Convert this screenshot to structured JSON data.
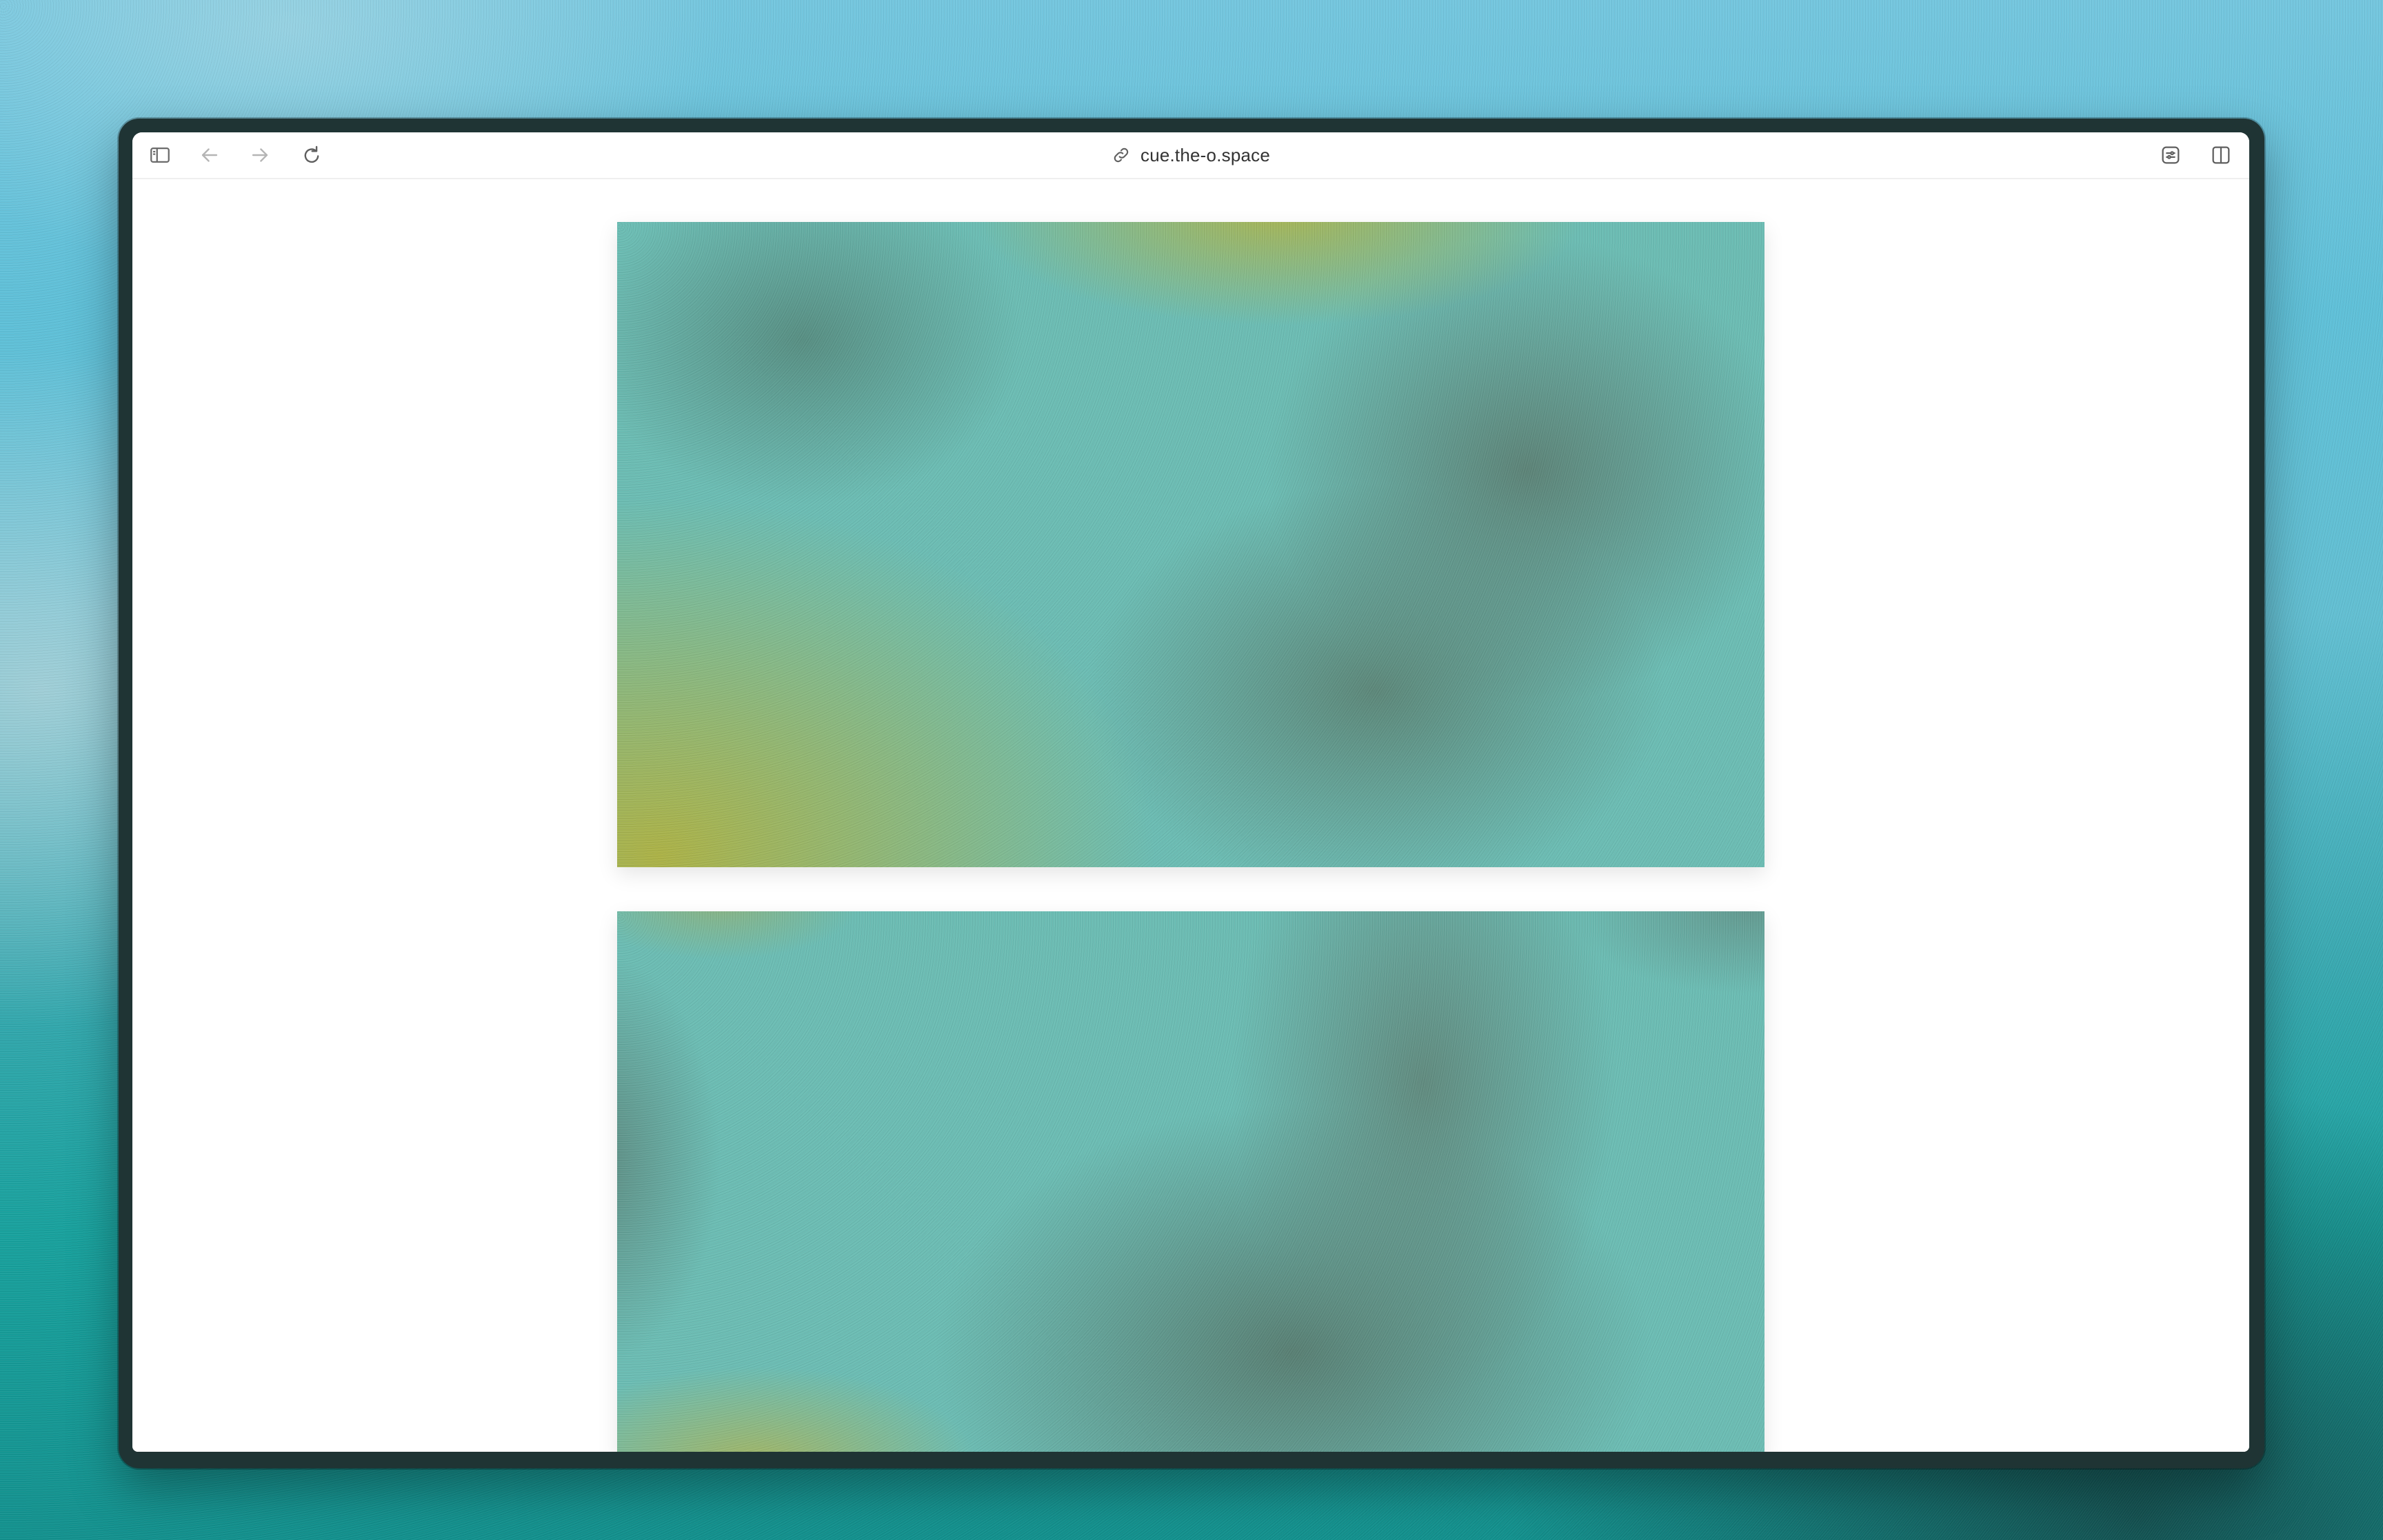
{
  "browser": {
    "address_bar": {
      "url": "cue.the-o.space"
    },
    "toolbar": {
      "icons": [
        "sidebar-icon",
        "back-arrow-icon",
        "forward-arrow-icon",
        "reload-icon",
        "link-icon",
        "extension-icon",
        "split-view-icon"
      ]
    }
  },
  "page": {
    "images": [
      "gradient-image-1",
      "gradient-image-2"
    ]
  },
  "colors": {
    "desktop_top": "#74c6de",
    "desktop_bottom": "#13918e",
    "window_frame": "#1f3434",
    "teal": "#6bbcb3",
    "dark_teal": "#5c8677",
    "olive": "#acb246"
  }
}
